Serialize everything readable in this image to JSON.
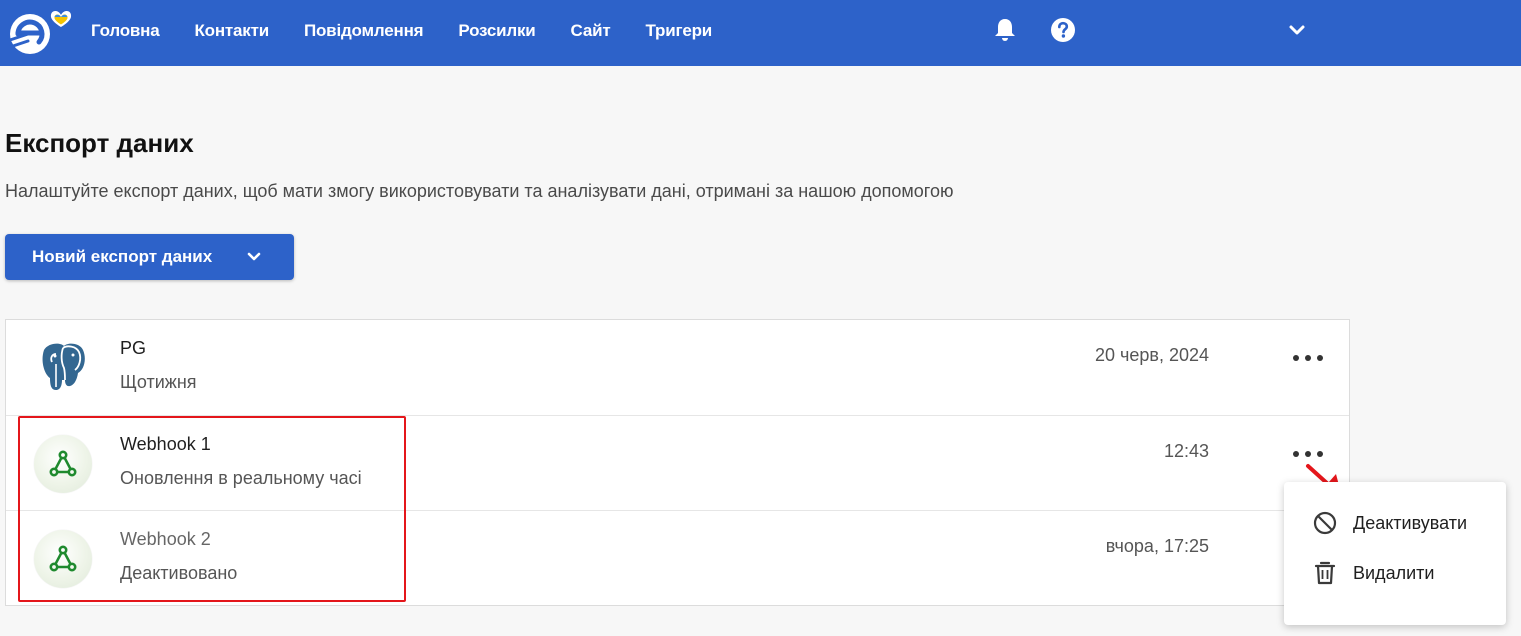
{
  "app": {
    "brand_color": "#2d62c9",
    "accent_heart": "#f5c400"
  },
  "nav": {
    "items": [
      {
        "label": "Головна"
      },
      {
        "label": "Контакти"
      },
      {
        "label": "Повідомлення"
      },
      {
        "label": "Розсилки"
      },
      {
        "label": "Сайт"
      },
      {
        "label": "Тригери"
      }
    ],
    "icons": [
      "bell-icon",
      "help-icon",
      "chevron-down-icon"
    ]
  },
  "page": {
    "title": "Експорт даних",
    "subtitle": "Налаштуйте експорт даних, щоб мати змогу використовувати та аналізувати дані, отримані за нашою допомогою",
    "new_export_label": "Новий експорт даних"
  },
  "exports": [
    {
      "name": "PG",
      "status": "Щотижня",
      "date": "20 черв, 2024",
      "icon": "postgresql-icon"
    },
    {
      "name": "Webhook 1",
      "status": "Оновлення в реальному часі",
      "date": "12:43",
      "icon": "webhook-icon"
    },
    {
      "name": "Webhook 2",
      "status": "Деактивовано",
      "date": "вчора, 17:25",
      "icon": "webhook-icon"
    }
  ],
  "context_menu": {
    "items": [
      {
        "label": "Деактивувати",
        "icon": "block-icon"
      },
      {
        "label": "Видалити",
        "icon": "trash-icon"
      }
    ]
  },
  "annotation_color": "#e4161b"
}
